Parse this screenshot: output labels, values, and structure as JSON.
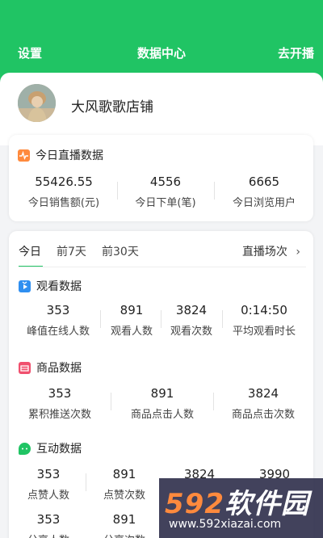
{
  "header": {
    "left": "设置",
    "title": "数据中心",
    "right": "去开播"
  },
  "profile": {
    "shop_name": "大风歌歌店铺"
  },
  "today": {
    "title": "今日直播数据",
    "stats": [
      {
        "value": "55426.55",
        "label": "今日销售额(元)"
      },
      {
        "value": "4556",
        "label": "今日下单(笔)"
      },
      {
        "value": "6665",
        "label": "今日浏览用户"
      }
    ]
  },
  "tabs": {
    "items": [
      "今日",
      "前7天",
      "前30天"
    ],
    "active": "今日",
    "sessions": "直播场次"
  },
  "watch": {
    "title": "观看数据",
    "stats": [
      {
        "value": "353",
        "label": "峰值在线人数"
      },
      {
        "value": "891",
        "label": "观看人数"
      },
      {
        "value": "3824",
        "label": "观看次数"
      },
      {
        "value": "0:14:50",
        "label": "平均观看时长"
      }
    ]
  },
  "goods": {
    "title": "商品数据",
    "stats": [
      {
        "value": "353",
        "label": "累积推送次数"
      },
      {
        "value": "891",
        "label": "商品点击人数"
      },
      {
        "value": "3824",
        "label": "商品点击次数"
      }
    ]
  },
  "interact": {
    "title": "互动数据",
    "row1": [
      {
        "value": "353",
        "label": "点赞人数"
      },
      {
        "value": "891",
        "label": "点赞次数"
      },
      {
        "value": "3824",
        "label": ""
      },
      {
        "value": "3990",
        "label": ""
      }
    ],
    "row2": [
      {
        "value": "353",
        "label": "分享人数"
      },
      {
        "value": "891",
        "label": "分享次数"
      }
    ]
  },
  "watermark": {
    "brand_digits": "592",
    "brand_text": "软件园",
    "url": "www.592xiazai.com"
  },
  "colors": {
    "primary": "#20c464",
    "watch_icon": "#2f8ff0",
    "goods_icon": "#f0506e",
    "interact_icon": "#20c464",
    "today_icon": "#ff8a3d"
  }
}
